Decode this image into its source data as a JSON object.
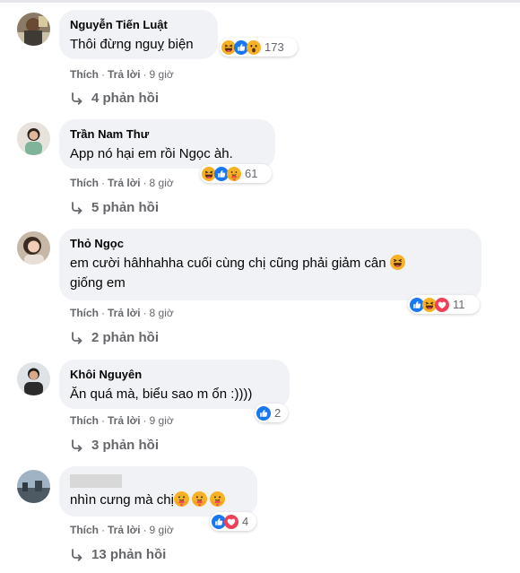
{
  "colors": {
    "bubble": "#f0f2f5",
    "meta_text": "#65676b",
    "text": "#050505",
    "like_blue": "#1877f2",
    "love_red": "#f33e58",
    "emoji_yellow": "#f7b125"
  },
  "comments": [
    {
      "author": "Nguyễn Tiến Luật",
      "text": "Thôi đừng nguỵ biện",
      "reactions": {
        "icons": [
          "haha",
          "like",
          "wow"
        ],
        "count": "173"
      },
      "actions": {
        "like": "Thích",
        "reply": "Trả lời",
        "time": "9 giờ"
      },
      "replies": "4 phản hồi"
    },
    {
      "author": "Trần Nam Thư",
      "text": "App nó hại em rồi Ngọc àh.",
      "reactions": {
        "icons": [
          "haha",
          "like",
          "care"
        ],
        "count": "61"
      },
      "actions": {
        "like": "Thích",
        "reply": "Trả lời",
        "time": "8 giờ"
      },
      "replies": "5 phản hồi"
    },
    {
      "author": "Thỏ Ngọc",
      "text": "em cười hâhhahha cuối cùng chị cũng phải giảm cân",
      "text_line2": "giống em",
      "inline_emoji": "laughing-emoji",
      "reactions": {
        "icons": [
          "like",
          "haha",
          "love"
        ],
        "count": "11"
      },
      "actions": {
        "like": "Thích",
        "reply": "Trả lời",
        "time": "8 giờ"
      },
      "replies": "2 phản hồi"
    },
    {
      "author": "Khôi Nguyên",
      "text": "Ăn quá mà, biểu sao m ổn :))))",
      "reactions": {
        "icons": [
          "like"
        ],
        "count": "2"
      },
      "actions": {
        "like": "Thích",
        "reply": "Trả lời",
        "time": "9 giờ"
      },
      "replies": "3 phản hồi"
    },
    {
      "author": "",
      "author_hidden": true,
      "text": "nhìn cưng mà chị",
      "inline_emoji": "smiling-emoji",
      "reactions": {
        "icons": [
          "like",
          "love"
        ],
        "count": "4"
      },
      "actions": {
        "like": "Thích",
        "reply": "Trả lời",
        "time": "9 giờ"
      },
      "replies": "13 phản hồi"
    }
  ]
}
